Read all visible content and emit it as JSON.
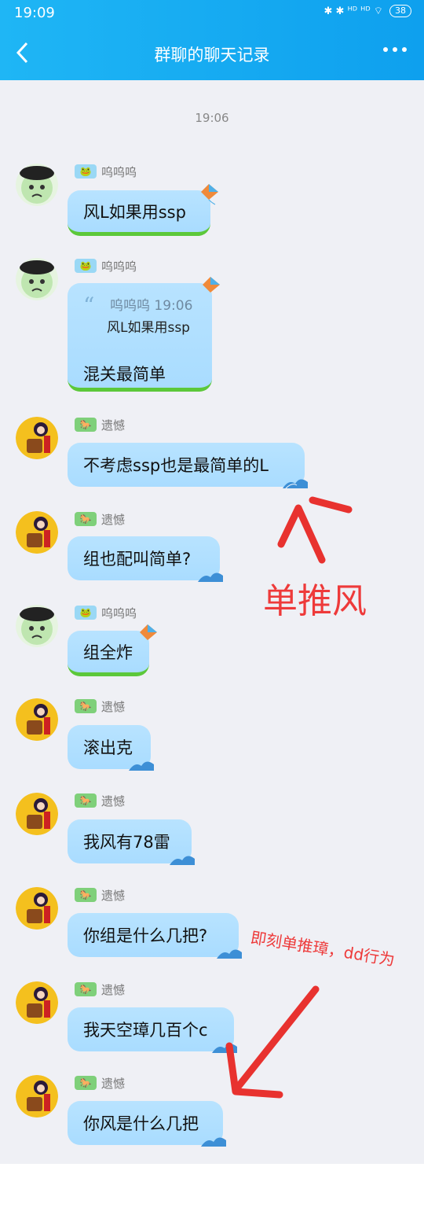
{
  "status_bar": {
    "time": "19:09",
    "icons": "✱ ✱ ᴴᴰ ᴴᴰ ⌔",
    "battery": "38"
  },
  "header": {
    "title": "群聊的聊天记录",
    "back_icon": "chevron-left-icon",
    "more_icon": "more-dots-icon"
  },
  "chat": {
    "timestamp": "19:06",
    "messages": [
      {
        "sender": "呜呜呜",
        "text": "风L如果用ssp"
      },
      {
        "sender": "呜呜呜",
        "quote_head": "呜呜呜 19:06",
        "quote_text": "风L如果用ssp",
        "text": "混关最简单"
      },
      {
        "sender": "遗憾",
        "text": "不考虑ssp也是最简单的L"
      },
      {
        "sender": "遗憾",
        "text": "组也配叫简单?"
      },
      {
        "sender": "呜呜呜",
        "text": "组全炸"
      },
      {
        "sender": "遗憾",
        "text": "滚出克"
      },
      {
        "sender": "遗憾",
        "text": "我风有78雷"
      },
      {
        "sender": "遗憾",
        "text": "你组是什么几把?"
      },
      {
        "sender": "遗憾",
        "text": "我天空璋几百个c"
      },
      {
        "sender": "遗憾",
        "text": "你风是什么几把"
      }
    ]
  },
  "annotations": {
    "big": "单推风",
    "small": "即刻单推璋，dd行为",
    "color": "#ee3a3a"
  },
  "colors": {
    "header": "#12a9f0",
    "chat_bg": "#eff0f5",
    "bubble": "#a9dcff",
    "grass": "#5cc83a"
  }
}
